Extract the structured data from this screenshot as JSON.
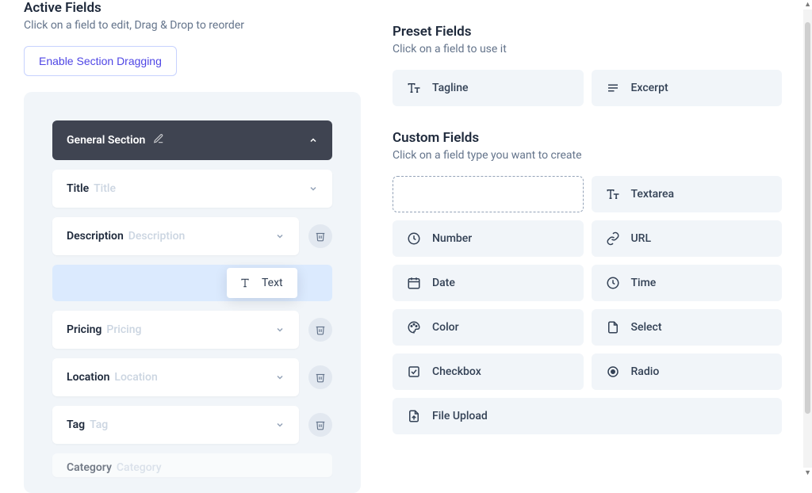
{
  "left": {
    "title": "Active Fields",
    "subtitle": "Click on a field to edit, Drag & Drop to reorder",
    "enable_button": "Enable Section Dragging",
    "section_header": "General Section",
    "fields": [
      {
        "name": "Title",
        "placeholder": "Title",
        "deletable": false
      },
      {
        "name": "Description",
        "placeholder": "Description",
        "deletable": true
      },
      {
        "name": "Pricing",
        "placeholder": "Pricing",
        "deletable": true
      },
      {
        "name": "Location",
        "placeholder": "Location",
        "deletable": true
      },
      {
        "name": "Tag",
        "placeholder": "Tag",
        "deletable": true
      },
      {
        "name": "Category",
        "placeholder": "Category",
        "deletable": true
      }
    ]
  },
  "dragging": {
    "label": "Text"
  },
  "preset": {
    "title": "Preset Fields",
    "subtitle": "Click on a field to use it",
    "items": [
      "Tagline",
      "Excerpt"
    ]
  },
  "custom": {
    "title": "Custom Fields",
    "subtitle": "Click on a field type you want to create",
    "types": [
      "",
      "Textarea",
      "Number",
      "URL",
      "Date",
      "Time",
      "Color",
      "Select",
      "Checkbox",
      "Radio",
      "File Upload"
    ]
  }
}
